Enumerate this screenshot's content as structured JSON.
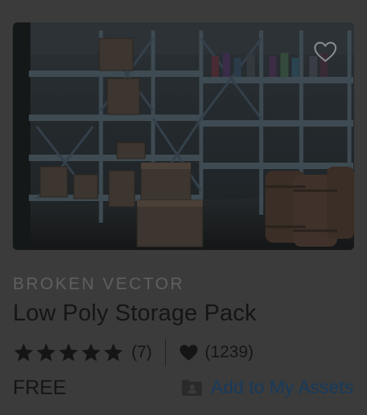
{
  "asset": {
    "publisher": "BROKEN VECTOR",
    "title": "Low Poly Storage Pack",
    "rating_stars": 5,
    "rating_count": "(7)",
    "favorites_count": "(1239)",
    "price": "FREE",
    "add_label": "Add to My Assets"
  },
  "icons": {
    "favorite_toggle": "heart-outline-icon",
    "rating": "star-icon",
    "favorites": "heart-icon",
    "add": "folder-user-icon"
  },
  "colors": {
    "background": "#3b3b3b",
    "link": "#173a5c",
    "text": "#151515",
    "publisher": "#5f5f5f"
  }
}
